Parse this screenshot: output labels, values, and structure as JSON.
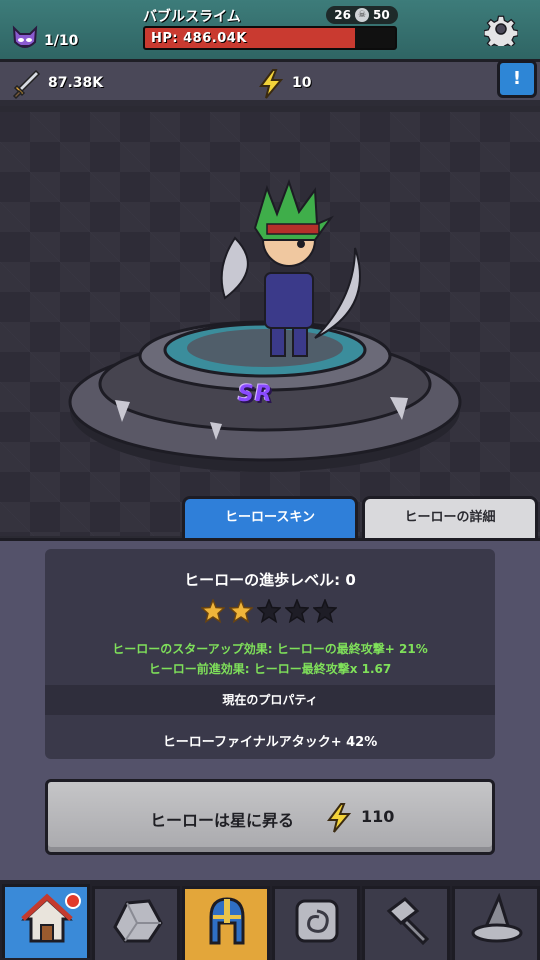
{
  "hud": {
    "stage_count": "1/10",
    "enemy_name": "バブルスライム",
    "enemy_level": "26",
    "enemy_level_secondary": "50",
    "hp_text": "HP: 486.04K",
    "hp_ratio": 0.84,
    "attack_power": "87.38K",
    "energy": "10",
    "info_label": "!"
  },
  "hero": {
    "rarity": "SR"
  },
  "tabs": [
    {
      "label": "ヒーロースキン",
      "active": true
    },
    {
      "label": "ヒーローの詳細",
      "active": false
    }
  ],
  "detail": {
    "title": "ヒーローの進歩レベル: 0",
    "stars_filled": 2,
    "stars_total": 5,
    "effect_line_1": "ヒーローのスターアップ効果: ヒーローの最終攻撃+ 21%",
    "effect_line_2": "ヒーロー前進効果: ヒーロー最終攻撃x 1.67",
    "properties_header": "現在のプロパティ",
    "property_value": "ヒーローファイナルアタック+ 42%"
  },
  "ascend_button": {
    "label": "ヒーローは星に昇る",
    "cost": "110"
  },
  "nav": {
    "items": [
      {
        "icon": "home-icon",
        "active": true,
        "badge": true
      },
      {
        "icon": "stone-icon",
        "active": false
      },
      {
        "icon": "helmet-icon",
        "active": true
      },
      {
        "icon": "rune-icon",
        "active": false
      },
      {
        "icon": "hammer-icon",
        "active": false
      },
      {
        "icon": "wizard-hat-icon",
        "active": false
      }
    ]
  },
  "colors": {
    "accent_blue": "#2f7fd9",
    "hp_red": "#c93a30",
    "effect_green": "#7fe05a",
    "rarity_purple": "#8a4bff",
    "hero_tab_gold": "#e3a63a"
  }
}
